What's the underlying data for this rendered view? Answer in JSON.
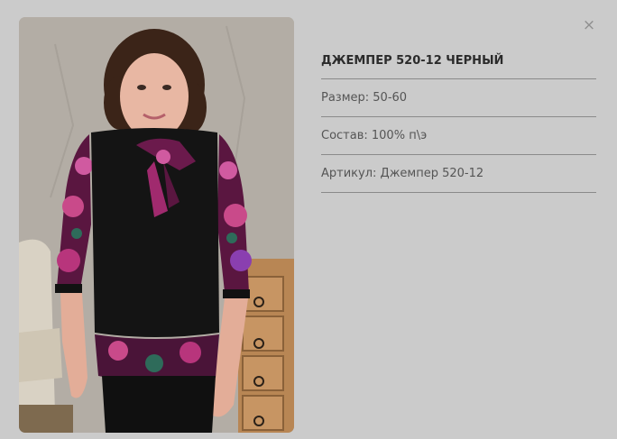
{
  "product": {
    "title": "ДЖЕМПЕР 520-12 ЧЕРНЫЙ",
    "size": "Размер: 50-60",
    "composition": "Состав: 100% п\\э",
    "article": "Артикул: Джемпер 520-12"
  },
  "modal": {
    "close_glyph": "×"
  },
  "photo": {
    "icon": "product-photo-image"
  },
  "colors": {
    "background": "#cbcbcb",
    "divider": "#8a8a8a",
    "title_text": "#2b2b2b",
    "body_text": "#555555"
  }
}
